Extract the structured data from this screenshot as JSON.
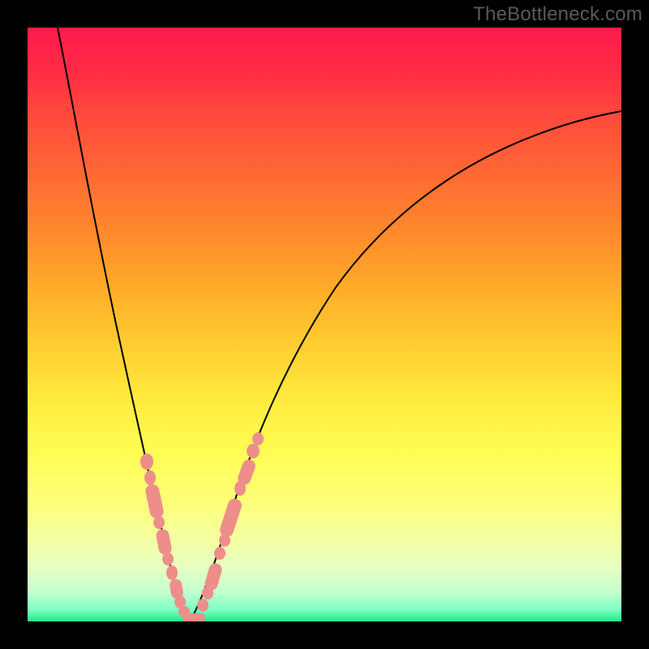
{
  "watermark": "TheBottleneck.com",
  "colors": {
    "bead": "#ed8e8b",
    "curve": "#000000",
    "frame": "#000000"
  },
  "chart_data": {
    "type": "line",
    "title": "",
    "xlabel": "",
    "ylabel": "",
    "xlim": [
      0,
      100
    ],
    "ylim": [
      0,
      100
    ],
    "grid": false,
    "legend": false,
    "annotations": [
      "TheBottleneck.com"
    ],
    "series": [
      {
        "name": "bottleneck-curve",
        "x": [
          0,
          3,
          6,
          9,
          12,
          15,
          18,
          21,
          23,
          25,
          27,
          30,
          34,
          38,
          44,
          52,
          62,
          74,
          88,
          100
        ],
        "values": [
          100,
          88,
          76,
          65,
          54,
          43,
          33,
          23,
          14,
          6,
          0,
          8,
          20,
          33,
          46,
          58,
          68,
          77,
          83,
          86
        ]
      }
    ],
    "minimum_x": 27,
    "bead_clusters": [
      {
        "side": "left",
        "x_range": [
          17,
          20
        ],
        "count": 3
      },
      {
        "side": "left",
        "x_range": [
          20,
          24
        ],
        "count": 5
      },
      {
        "side": "left",
        "x_range": [
          24,
          27
        ],
        "count": 4
      },
      {
        "side": "right",
        "x_range": [
          27,
          30
        ],
        "count": 4
      },
      {
        "side": "right",
        "x_range": [
          30,
          35
        ],
        "count": 6
      },
      {
        "side": "right",
        "x_range": [
          35,
          38
        ],
        "count": 3
      }
    ]
  }
}
